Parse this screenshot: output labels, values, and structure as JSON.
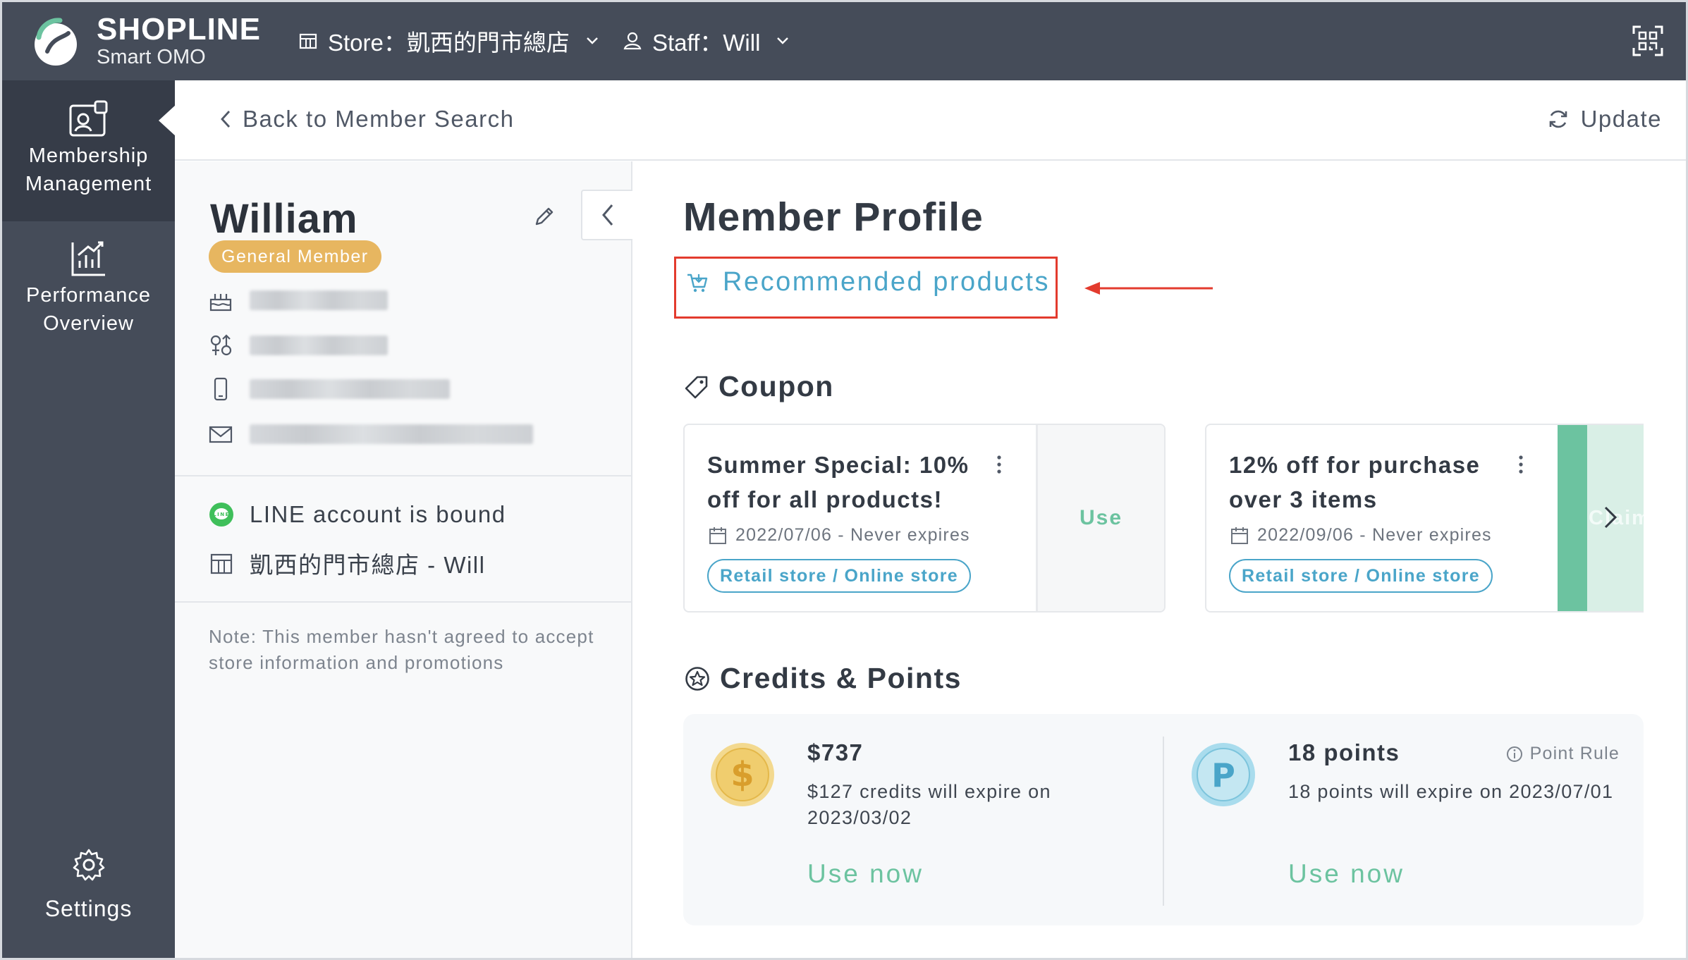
{
  "brand": {
    "name": "SHOPLINE",
    "sub": "Smart OMO"
  },
  "topbar": {
    "store_label": "Store：凱西的門市總店",
    "staff_label": "Staff：Will"
  },
  "sidebar": {
    "items": [
      {
        "label_line1": "Membership",
        "label_line2": "Management"
      },
      {
        "label_line1": "Performance",
        "label_line2": "Overview"
      }
    ],
    "settings_label": "Settings"
  },
  "header": {
    "back_label": "Back to Member Search",
    "update_label": "Update"
  },
  "profile": {
    "name": "William",
    "tier": "General Member",
    "line_status": "LINE account is bound",
    "store_staff": "凱西的門市總店 - Will",
    "note": "Note: This member hasn't agreed to accept store information and promotions"
  },
  "main": {
    "title": "Member Profile",
    "recommended_label": "Recommended products",
    "coupon_title": "Coupon",
    "coupons": [
      {
        "title": "Summer Special: 10% off for all products!",
        "date": "2022/07/06 - Never expires",
        "channel": "Retail store / Online store",
        "action": "Use"
      },
      {
        "title": "12% off for purchase over 3 items",
        "date": "2022/09/06 - Never expires",
        "channel": "Retail store / Online store",
        "action": "Claim"
      }
    ],
    "credits_title": "Credits & Points",
    "credits": {
      "amount": "$737",
      "expiry": "$127 credits will expire on 2023/03/02",
      "action": "Use now"
    },
    "points": {
      "amount": "18 points",
      "expiry": "18 points will expire on 2023/07/01",
      "action": "Use now",
      "rule_label": "Point Rule"
    }
  },
  "colors": {
    "sidebar": "#454c59",
    "sidebar_active": "#363c48",
    "badge": "#e7b660",
    "link_blue": "#4aa5c9",
    "green": "#6cc3a0",
    "annotation_red": "#e33b2e",
    "line_green": "#3fbf5a"
  }
}
